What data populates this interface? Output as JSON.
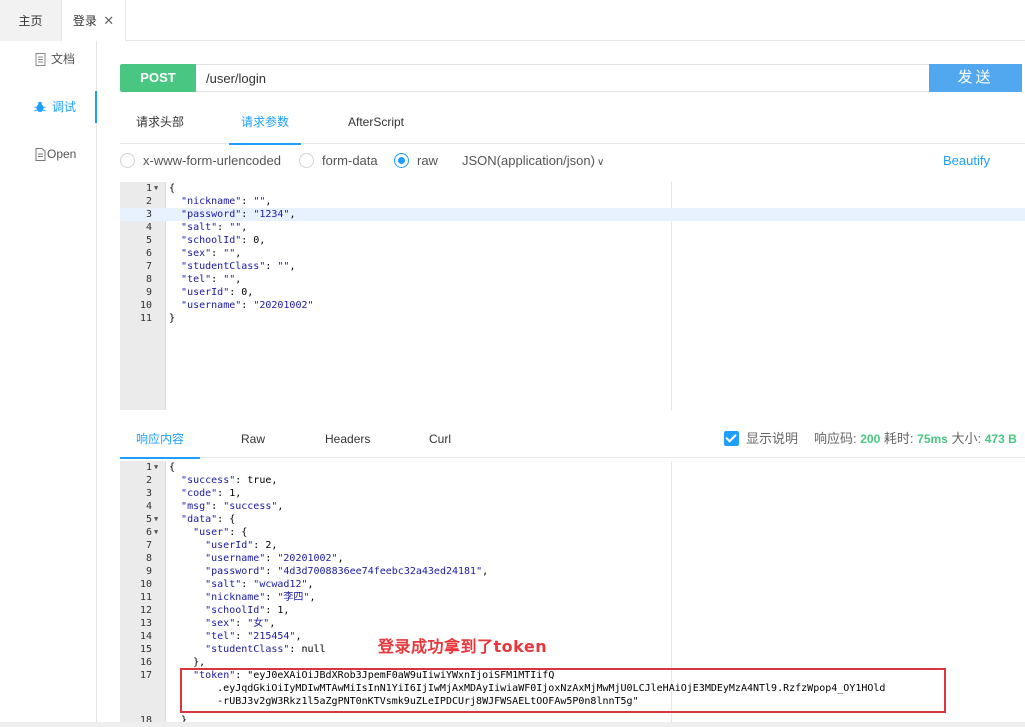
{
  "tabs": {
    "home": "主页",
    "login": "登录",
    "close": "✕"
  },
  "sidebar": {
    "items": [
      {
        "label": "文档",
        "icon": "document-icon"
      },
      {
        "label": "调试",
        "icon": "bug-icon",
        "active": true
      },
      {
        "label": "Open",
        "icon": "file-icon"
      }
    ]
  },
  "request": {
    "method": "POST",
    "url": "/user/login",
    "send": "发送"
  },
  "request_tabs": [
    "请求头部",
    "请求参数",
    "AfterScript"
  ],
  "body_types": {
    "urlencoded": "x-www-form-urlencoded",
    "formdata": "form-data",
    "raw": "raw",
    "json_select": "JSON(application/json)",
    "beautify": "Beautify"
  },
  "request_body": [
    {
      "n": "1",
      "fold": "▼",
      "code": "{"
    },
    {
      "n": "2",
      "code": "  \"nickname\": \"\","
    },
    {
      "n": "3",
      "code": "  \"password\": \"1234\","
    },
    {
      "n": "4",
      "code": "  \"salt\": \"\","
    },
    {
      "n": "5",
      "code": "  \"schoolId\": 0,"
    },
    {
      "n": "6",
      "code": "  \"sex\": \"\","
    },
    {
      "n": "7",
      "code": "  \"studentClass\": \"\","
    },
    {
      "n": "8",
      "code": "  \"tel\": \"\","
    },
    {
      "n": "9",
      "code": "  \"userId\": 0,"
    },
    {
      "n": "10",
      "code": "  \"username\": \"20201002\""
    },
    {
      "n": "11",
      "code": "}"
    }
  ],
  "response_tabs": [
    "响应内容",
    "Raw",
    "Headers",
    "Curl"
  ],
  "response_meta": {
    "show_desc": "显示说明",
    "code_label": "响应码:",
    "code": "200",
    "time_label": "耗时:",
    "time": "75ms",
    "size_label": "大小:",
    "size": "473 B"
  },
  "response_body": [
    {
      "n": "1",
      "fold": "▼",
      "code": "{"
    },
    {
      "n": "2",
      "code": "  \"success\": true,"
    },
    {
      "n": "3",
      "code": "  \"code\": 1,"
    },
    {
      "n": "4",
      "code": "  \"msg\": \"success\","
    },
    {
      "n": "5",
      "fold": "▼",
      "code": "  \"data\": {"
    },
    {
      "n": "6",
      "fold": "▼",
      "code": "    \"user\": {"
    },
    {
      "n": "7",
      "code": "      \"userId\": 2,"
    },
    {
      "n": "8",
      "code": "      \"username\": \"20201002\","
    },
    {
      "n": "9",
      "code": "      \"password\": \"4d3d7008836ee74feebc32a43ed24181\","
    },
    {
      "n": "10",
      "code": "      \"salt\": \"wcwad12\","
    },
    {
      "n": "11",
      "code": "      \"nickname\": \"李四\","
    },
    {
      "n": "12",
      "code": "      \"schoolId\": 1,"
    },
    {
      "n": "13",
      "code": "      \"sex\": \"女\","
    },
    {
      "n": "14",
      "code": "      \"tel\": \"215454\","
    },
    {
      "n": "15",
      "code": "      \"studentClass\": null"
    },
    {
      "n": "16",
      "code": "    },"
    },
    {
      "n": "17",
      "code": "    \"token\": \"eyJ0eXAiOiJBdXRob3JpemF0aW9uIiwiYWxnIjoiSFM1MTIifQ"
    },
    {
      "n": "",
      "code": "        .eyJqdGkiOiIyMDIwMTAwMiIsInN1YiI6IjIwMjAxMDAyIiwiaWF0IjoxNzAxMjMwMjU0LCJleHAiOjE3MDEyMzA4NTl9.RzfzWpop4_OY1HOld"
    },
    {
      "n": "",
      "code": "        -rUBJ3v2gW3Rkz1l5aZgPNT0nKTVsmk9uZLeIPDCUrj8WJFWSAELtOOFAw5P0n8lnnT5g\""
    },
    {
      "n": "18",
      "code": "  }"
    }
  ],
  "annotation": "登录成功拿到了token"
}
